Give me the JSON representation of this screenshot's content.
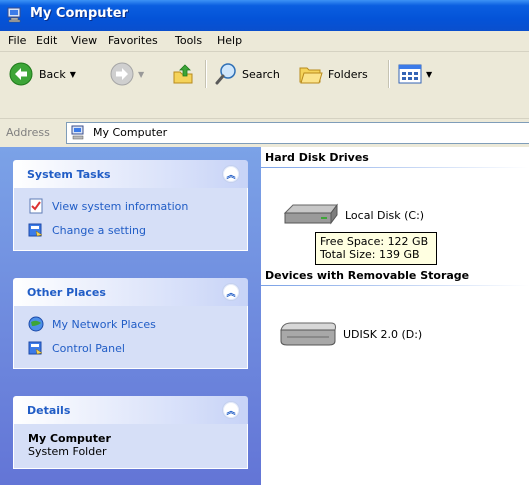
{
  "window": {
    "title": "My Computer"
  },
  "menu": [
    "File",
    "Edit",
    "View",
    "Favorites",
    "Tools",
    "Help"
  ],
  "toolbar": {
    "back_label": "Back",
    "search_label": "Search",
    "folders_label": "Folders"
  },
  "address": {
    "label": "Address",
    "value": "My Computer"
  },
  "left_pane": {
    "system_tasks": {
      "title": "System Tasks",
      "items": [
        "View system information",
        "Change a setting"
      ]
    },
    "other_places": {
      "title": "Other Places",
      "items": [
        "My Network Places",
        "Control Panel"
      ]
    },
    "details": {
      "title": "Details",
      "name": "My Computer",
      "type": "System Folder"
    }
  },
  "content": {
    "hard_disk_header": "Hard Disk Drives",
    "removable_header": "Devices with Removable Storage",
    "drives": [
      {
        "label": "Local Disk (C:)"
      },
      {
        "label": "UDISK 2.0 (D:)"
      }
    ],
    "tooltip": {
      "free": "Free Space: 122 GB",
      "total": "Total Size: 139 GB"
    }
  }
}
